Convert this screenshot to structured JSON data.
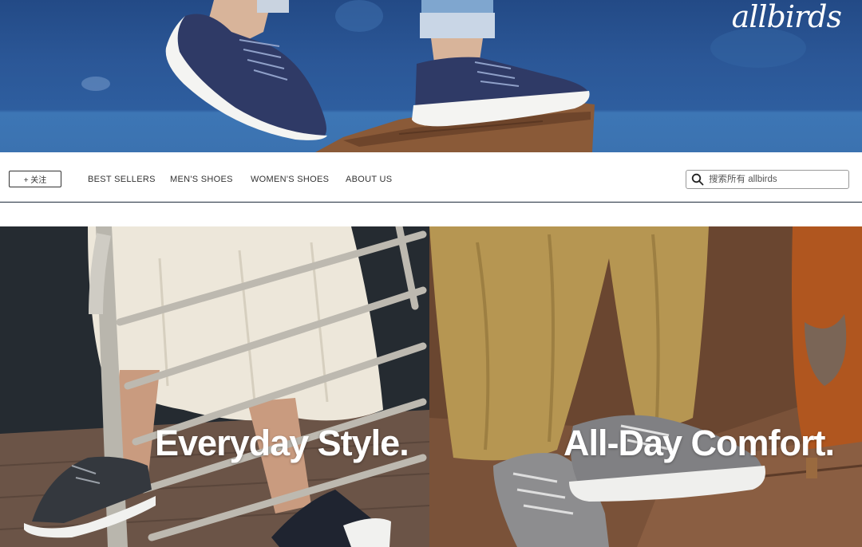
{
  "brand": {
    "logo_text": "allbirds"
  },
  "nav": {
    "follow_label": "+ 关注",
    "links": [
      "BEST SELLERS",
      "MEN'S SHOES",
      "WOMEN'S SHOES",
      "ABOUT US"
    ],
    "search_placeholder": "搜索所有 allbirds",
    "search_icon": "search-icon"
  },
  "tiles": [
    {
      "caption": "Everyday Style."
    },
    {
      "caption": "All-Day Comfort."
    }
  ],
  "colors": {
    "hero_blue": "#2b5797",
    "shoe_navy": "#2f3a66",
    "sole_white": "#f4f4f2",
    "nav_divider": "#1d2b3a"
  }
}
